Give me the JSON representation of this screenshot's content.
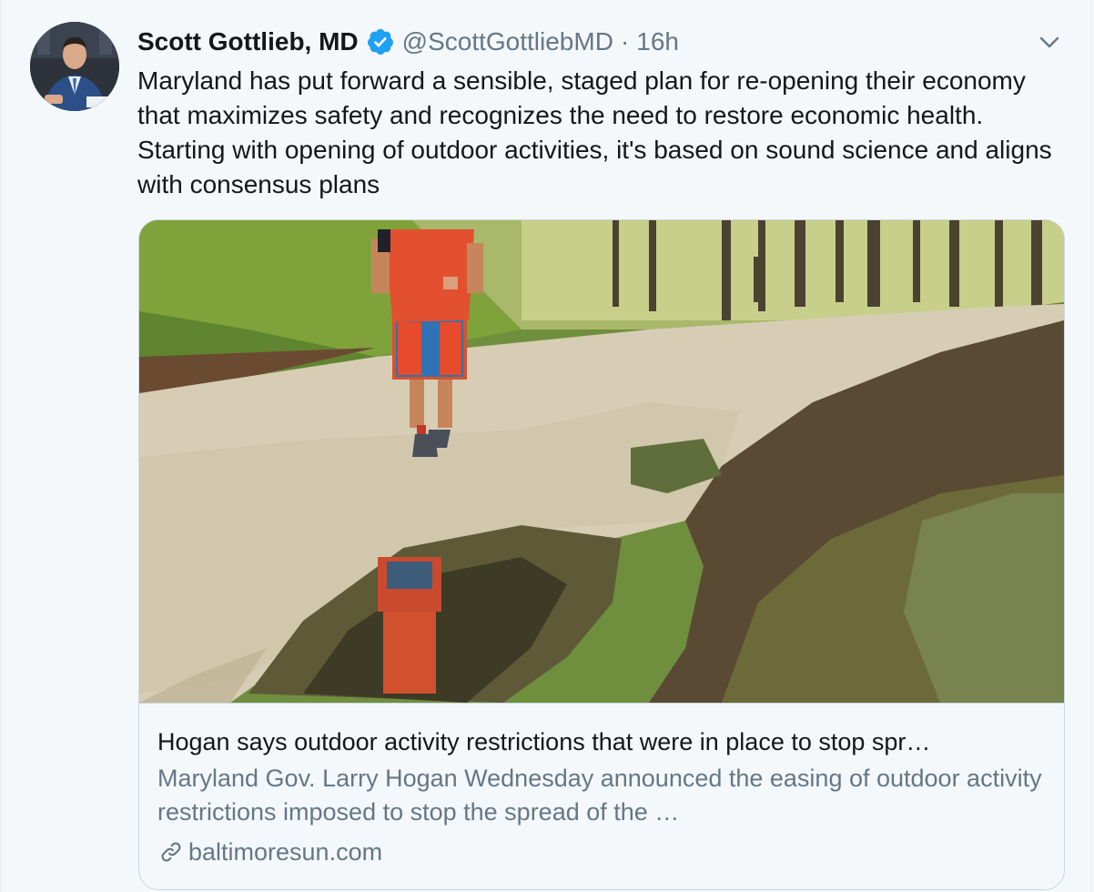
{
  "tweet": {
    "author_name": "Scott Gottlieb, MD",
    "handle": "@ScottGottliebMD",
    "separator": "·",
    "time": "16h",
    "text": "Maryland has put forward a sensible, staged plan for re-opening their economy that maximizes safety and recognizes the need to restore economic health. Starting with opening of outdoor activities, it's based on sound science and aligns with consensus plans",
    "verified_icon": "verified-badge-icon",
    "menu_icon": "chevron-down-icon"
  },
  "card": {
    "image_icon": "runner-on-trail-photo",
    "title": "Hogan says outdoor activity restrictions that were in place to stop spr…",
    "description": "Maryland Gov. Larry Hogan Wednesday announced the easing of outdoor activity restrictions imposed to stop the spread of the …",
    "domain": "baltimoresun.com",
    "link_icon": "link-icon"
  },
  "colors": {
    "background": "#f5f8fa",
    "text_primary": "#14171a",
    "text_secondary": "#657786",
    "verified_blue": "#1da1f2",
    "border": "#ccd6dd"
  }
}
